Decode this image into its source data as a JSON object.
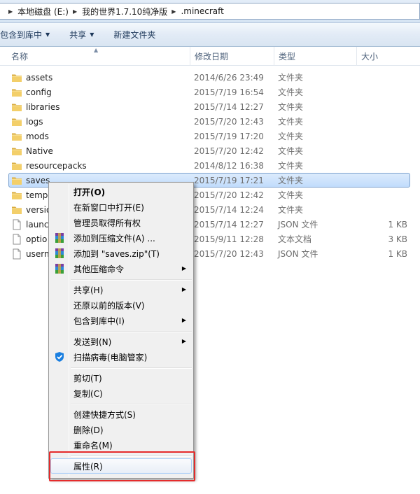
{
  "address": {
    "crumbs": [
      "本地磁盘 (E:)",
      "我的世界1.7.10纯净版",
      ".minecraft"
    ]
  },
  "toolbar": {
    "include_label": "包含到库中",
    "share_label": "共享",
    "newfolder_label": "新建文件夹"
  },
  "columns": {
    "name": "名称",
    "date": "修改日期",
    "type": "类型",
    "size": "大小"
  },
  "files": [
    {
      "name": "assets",
      "date": "2014/6/26 23:49",
      "type": "文件夹",
      "size": "",
      "kind": "folder"
    },
    {
      "name": "config",
      "date": "2015/7/19 16:54",
      "type": "文件夹",
      "size": "",
      "kind": "folder"
    },
    {
      "name": "libraries",
      "date": "2015/7/14 12:27",
      "type": "文件夹",
      "size": "",
      "kind": "folder"
    },
    {
      "name": "logs",
      "date": "2015/7/20 12:43",
      "type": "文件夹",
      "size": "",
      "kind": "folder"
    },
    {
      "name": "mods",
      "date": "2015/7/19 17:20",
      "type": "文件夹",
      "size": "",
      "kind": "folder"
    },
    {
      "name": "Native",
      "date": "2015/7/20 12:42",
      "type": "文件夹",
      "size": "",
      "kind": "folder"
    },
    {
      "name": "resourcepacks",
      "date": "2014/8/12 16:38",
      "type": "文件夹",
      "size": "",
      "kind": "folder"
    },
    {
      "name": "saves",
      "date": "2015/7/19 17:21",
      "type": "文件夹",
      "size": "",
      "kind": "folder"
    },
    {
      "name": "temp",
      "date": "2015/7/20 12:42",
      "type": "文件夹",
      "size": "",
      "kind": "folder"
    },
    {
      "name": "versio",
      "date": "2015/7/14 12:24",
      "type": "文件夹",
      "size": "",
      "kind": "folder"
    },
    {
      "name": "launc",
      "date": "2015/7/14 12:27",
      "type": "JSON 文件",
      "size": "1 KB",
      "kind": "file"
    },
    {
      "name": "optio",
      "date": "2015/9/11 12:28",
      "type": "文本文档",
      "size": "3 KB",
      "kind": "file"
    },
    {
      "name": "usern",
      "date": "2015/7/20 12:43",
      "type": "JSON 文件",
      "size": "1 KB",
      "kind": "file"
    }
  ],
  "menu": {
    "open": "打开(O)",
    "open_new_window": "在新窗口中打开(E)",
    "take_ownership": "管理员取得所有权",
    "add_archive": "添加到压缩文件(A) ...",
    "add_zip": "添加到 \"saves.zip\"(T)",
    "other_compress": "其他压缩命令",
    "share": "共享(H)",
    "restore_prev": "还原以前的版本(V)",
    "include_library": "包含到库中(I)",
    "send_to": "发送到(N)",
    "scan_virus": "扫描病毒(电脑管家)",
    "cut": "剪切(T)",
    "copy": "复制(C)",
    "create_shortcut": "创建快捷方式(S)",
    "delete": "删除(D)",
    "rename": "重命名(M)",
    "properties": "属性(R)"
  },
  "colors": {
    "folder": "#e8c25a",
    "selection": "#c1dcfc",
    "annotation": "#e52b2b"
  }
}
